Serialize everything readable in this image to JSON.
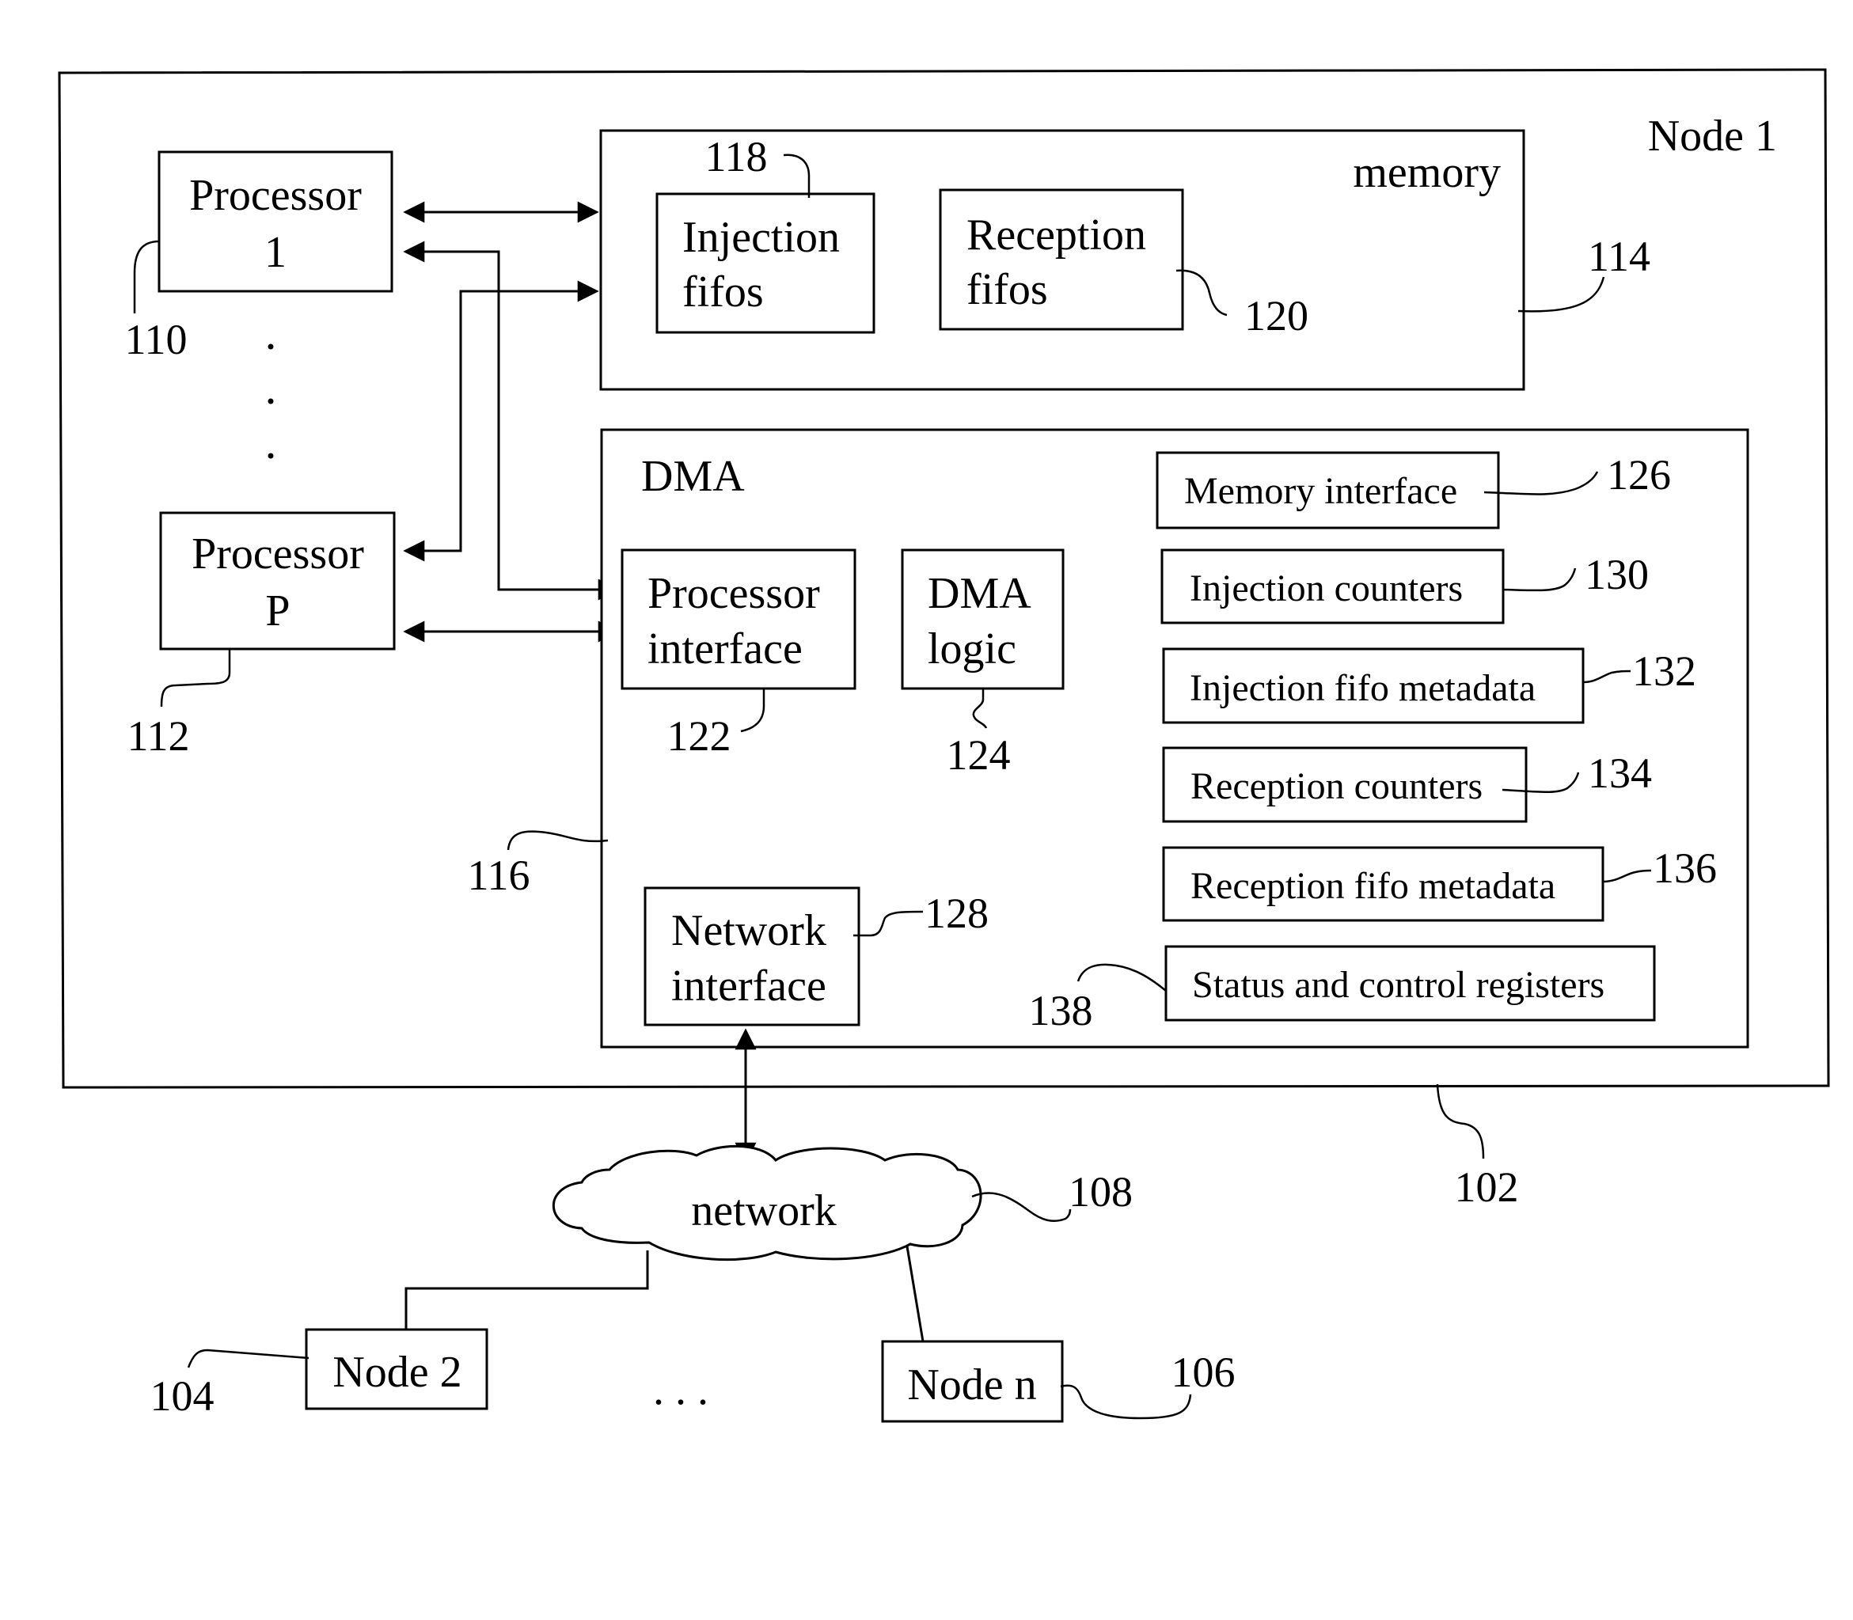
{
  "figure": {
    "node1": {
      "label": "Node 1",
      "ref": "102",
      "processor1": {
        "line1": "Processor",
        "line2": "1",
        "ref": "110"
      },
      "processorP": {
        "line1": "Processor",
        "line2": "P",
        "ref": "112"
      },
      "memory": {
        "label": "memory",
        "ref": "114",
        "injection_fifos": {
          "line1": "Injection",
          "line2": "fifos",
          "ref": "118"
        },
        "reception_fifos": {
          "line1": "Reception",
          "line2": "fifos",
          "ref": "120"
        }
      },
      "dma": {
        "label": "DMA",
        "ref": "116",
        "processor_interface": {
          "line1": "Processor",
          "line2": "interface",
          "ref": "122"
        },
        "dma_logic": {
          "line1": "DMA",
          "line2": "logic",
          "ref": "124"
        },
        "network_interface": {
          "line1": "Network",
          "line2": "interface",
          "ref": "128"
        },
        "components": [
          {
            "label": "Memory interface",
            "ref": "126"
          },
          {
            "label": "Injection counters",
            "ref": "130"
          },
          {
            "label": "Injection fifo metadata",
            "ref": "132"
          },
          {
            "label": "Reception counters",
            "ref": "134"
          },
          {
            "label": "Reception fifo metadata",
            "ref": "136"
          },
          {
            "label": "Status and control registers",
            "ref": "138"
          }
        ]
      }
    },
    "network": {
      "label": "network",
      "ref": "108"
    },
    "node2": {
      "label": "Node 2",
      "ref": "104"
    },
    "nodeN": {
      "label": "Node n",
      "ref": "106"
    },
    "ellipsis": ". . ."
  }
}
